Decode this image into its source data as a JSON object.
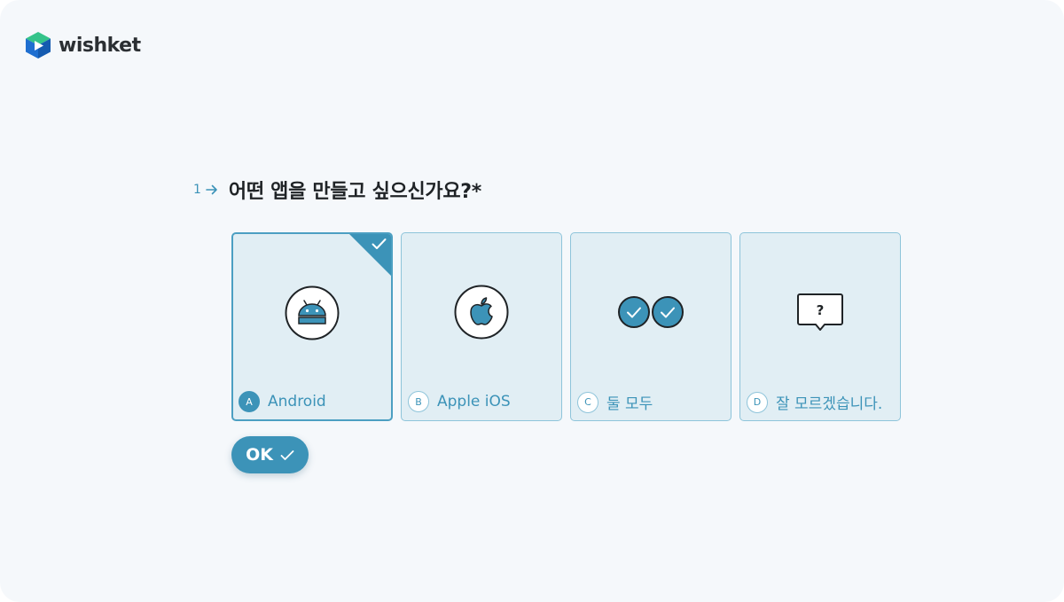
{
  "brand": {
    "name": "wishket",
    "logo_icon": "wishket-cube-logo"
  },
  "question": {
    "number": "1",
    "arrow_icon": "arrow-right-icon",
    "text": "어떤 앱을 만들고 싶으신가요?*"
  },
  "choices": [
    {
      "key": "A",
      "label": "Android",
      "icon": "android-icon",
      "selected": true
    },
    {
      "key": "B",
      "label": "Apple iOS",
      "icon": "apple-icon",
      "selected": false
    },
    {
      "key": "C",
      "label": "둘 모두",
      "icon": "double-check-icon",
      "selected": false
    },
    {
      "key": "D",
      "label": "잘 모르겠습니다.",
      "icon": "question-bubble-icon",
      "selected": false
    }
  ],
  "ok_button": {
    "label": "OK",
    "icon": "check-icon"
  },
  "colors": {
    "accent": "#3c93b8",
    "card_bg": "#e1eef4",
    "card_border": "#8ec4da",
    "page_bg": "#f5f8fb",
    "brand_green": "#27b47c",
    "brand_blue": "#1f6fd0"
  }
}
